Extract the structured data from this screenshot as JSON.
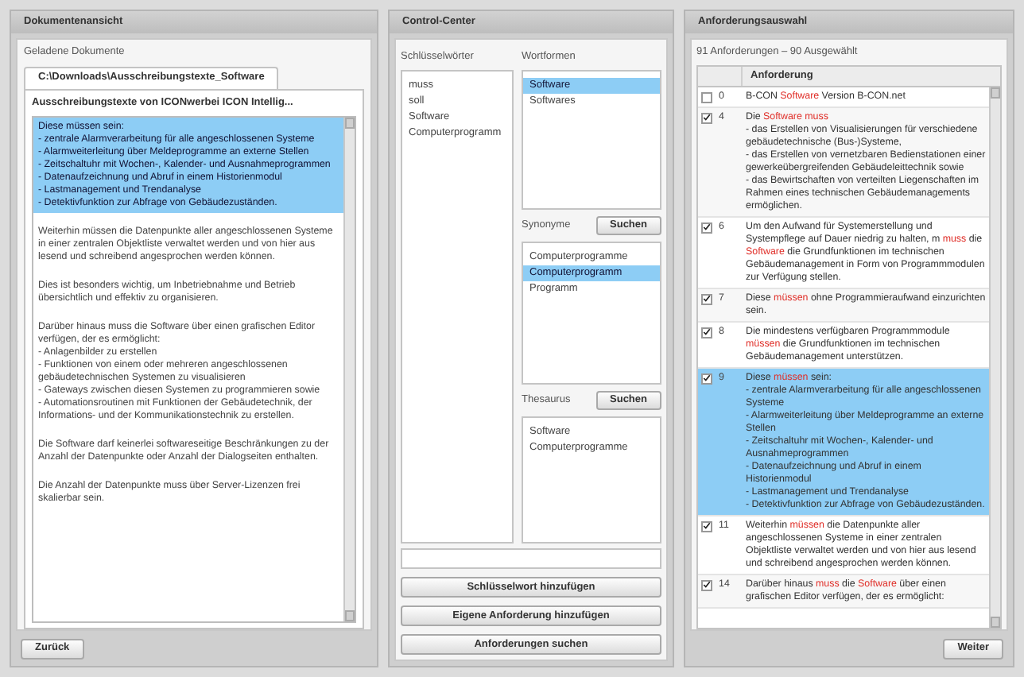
{
  "document_view": {
    "title": "Dokumentenansicht",
    "loaded_label": "Geladene Dokumente",
    "tabs": [
      {
        "label": "C:\\Downloads\\Ausschreibungstexte_Software",
        "selected": true
      }
    ],
    "document_title": "Ausschreibungstexte von ICONwerbei ICON Intellig...",
    "paragraphs": [
      {
        "text": "Diese müssen sein:\n- zentrale Alarmverarbeitung für alle angeschlossenen Systeme\n- Alarmweiterleitung über Meldeprogramme an externe Stellen\n- Zeitschaltuhr mit Wochen-, Kalender- und Ausnahmeprogrammen\n- Datenaufzeichnung und Abruf in einem Historienmodul\n- Lastmanagement und Trendanalyse\n- Detektivfunktion zur Abfrage von Gebäudezuständen.",
        "selected": true
      },
      {
        "text": "Weiterhin müssen die Datenpunkte aller angeschlossenen Systeme in einer zentralen Objektliste verwaltet werden und von hier aus lesend und schreibend angesprochen werden können.",
        "selected": false
      },
      {
        "text": "Dies ist besonders wichtig, um Inbetriebnahme und Betrieb übersichtlich und effektiv zu organisieren.",
        "selected": false
      },
      {
        "text": "Darüber hinaus muss die Software über einen grafischen Editor verfügen, der es ermöglicht:\n- Anlagenbilder zu erstellen\n- Funktionen von einem oder mehreren angeschlossenen gebäudetechnischen Systemen zu visualisieren\n- Gateways zwischen diesen Systemen zu programmieren sowie\n- Automationsroutinen mit Funktionen der Gebäudetechnik, der Informations- und der Kommunikationstechnik zu erstellen.",
        "selected": false
      },
      {
        "text": "Die Software darf keinerlei softwareseitige Beschränkungen zu der Anzahl der Datenpunkte oder Anzahl der Dialogseiten enthalten.",
        "selected": false
      },
      {
        "text": "Die Anzahl der Datenpunkte muss über Server-Lizenzen frei skalierbar sein.",
        "selected": false
      }
    ],
    "back_button": "Zurück"
  },
  "control_center": {
    "title": "Control-Center",
    "keywords": {
      "label": "Schlüsselwörter",
      "items": [
        {
          "text": "muss",
          "selected": false
        },
        {
          "text": "soll",
          "selected": false
        },
        {
          "text": "Software",
          "selected": false
        },
        {
          "text": "Computerprogramm",
          "selected": false
        }
      ]
    },
    "word_forms": {
      "label": "Wortformen",
      "items": [
        {
          "text": "Software",
          "selected": true
        },
        {
          "text": "Softwares",
          "selected": false
        }
      ]
    },
    "synonyms": {
      "label": "Synonyme",
      "button": "Suchen",
      "items": [
        {
          "text": "Computerprogramme",
          "selected": false
        },
        {
          "text": "Computerprogramm",
          "selected": true
        },
        {
          "text": "Programm",
          "selected": false
        }
      ]
    },
    "thesaurus": {
      "label": "Thesaurus",
      "button": "Suchen",
      "items": [
        {
          "text": "Software",
          "selected": false
        },
        {
          "text": "Computerprogramme",
          "selected": false
        }
      ]
    },
    "buttons": [
      "Schlüsselwort hinzufügen",
      "Eigene Anforderung hinzufügen",
      "Anforderungen suchen"
    ]
  },
  "requirements": {
    "title": "Anforderungsauswahl",
    "summary": "91 Anforderungen – 90 Ausgewählt",
    "column": "Anforderung",
    "rows": [
      {
        "number": "0",
        "checked": false,
        "selected": false,
        "segments": [
          {
            "text": "B-CON ",
            "highlighted": false
          },
          {
            "text": "Software",
            "highlighted": true
          },
          {
            "text": " Version B-CON.net",
            "highlighted": false
          }
        ]
      },
      {
        "number": "4",
        "checked": true,
        "selected": false,
        "segments": [
          {
            "text": "Die ",
            "highlighted": false
          },
          {
            "text": "Software muss",
            "highlighted": true
          },
          {
            "text": "\n- das Erstellen von Visualisierungen für verschiedene gebäudetechnische (Bus-)Systeme,\n- das Erstellen von vernetzbaren Bedienstationen einer gewerkeübergreifenden Gebäudeleittechnik sowie\n- das Bewirtschaften von verteilten Liegenschaften im Rahmen eines technischen Gebäudemanagements ermöglichen.",
            "highlighted": false
          }
        ]
      },
      {
        "number": "6",
        "checked": true,
        "selected": false,
        "segments": [
          {
            "text": "Um den Aufwand für Systemerstellung und Systempflege auf Dauer niedrig zu halten, m ",
            "highlighted": false
          },
          {
            "text": "muss",
            "highlighted": true
          },
          {
            "text": " die ",
            "highlighted": false
          },
          {
            "text": "Software",
            "highlighted": true
          },
          {
            "text": " die Grundfunktionen im technischen Gebäudemanagement in Form von Programmmodulen zur Verfügung stellen.",
            "highlighted": false
          }
        ]
      },
      {
        "number": "7",
        "checked": true,
        "selected": false,
        "segments": [
          {
            "text": "Diese ",
            "highlighted": false
          },
          {
            "text": "müssen",
            "highlighted": true
          },
          {
            "text": " ohne Programmieraufwand einzurichten sein.",
            "highlighted": false
          }
        ]
      },
      {
        "number": "8",
        "checked": true,
        "selected": false,
        "segments": [
          {
            "text": "Die mindestens verfügbaren Programmmodule ",
            "highlighted": false
          },
          {
            "text": "müssen",
            "highlighted": true
          },
          {
            "text": " die Grundfunktionen im technischen Gebäudemanagement unterstützen.",
            "highlighted": false
          }
        ]
      },
      {
        "number": "9",
        "checked": true,
        "selected": true,
        "segments": [
          {
            "text": "Diese ",
            "highlighted": false
          },
          {
            "text": "müssen",
            "highlighted": true
          },
          {
            "text": " sein:\n- zentrale Alarmverarbeitung für alle angeschlossenen Systeme\n- Alarmweiterleitung über Meldeprogramme an externe Stellen\n- Zeitschaltuhr mit Wochen-, Kalender- und Ausnahmeprogrammen\n- Datenaufzeichnung und Abruf in einem Historienmodul\n- Lastmanagement und Trendanalyse\n- Detektivfunktion zur Abfrage von Gebäudezuständen.",
            "highlighted": false
          }
        ]
      },
      {
        "number": "11",
        "checked": true,
        "selected": false,
        "segments": [
          {
            "text": "Weiterhin ",
            "highlighted": false
          },
          {
            "text": "müssen",
            "highlighted": true
          },
          {
            "text": " die Datenpunkte aller angeschlossenen Systeme in einer zentralen Objektliste verwaltet werden und von hier aus lesend und schreibend angesprochen werden können.",
            "highlighted": false
          }
        ]
      },
      {
        "number": "14",
        "checked": true,
        "selected": false,
        "segments": [
          {
            "text": "Darüber hinaus ",
            "highlighted": false
          },
          {
            "text": "muss",
            "highlighted": true
          },
          {
            "text": " die ",
            "highlighted": false
          },
          {
            "text": "Software",
            "highlighted": true
          },
          {
            "text": " über einen grafischen Editor verfügen, der es ermöglicht:",
            "highlighted": false
          }
        ]
      }
    ],
    "next_button": "Weiter"
  }
}
